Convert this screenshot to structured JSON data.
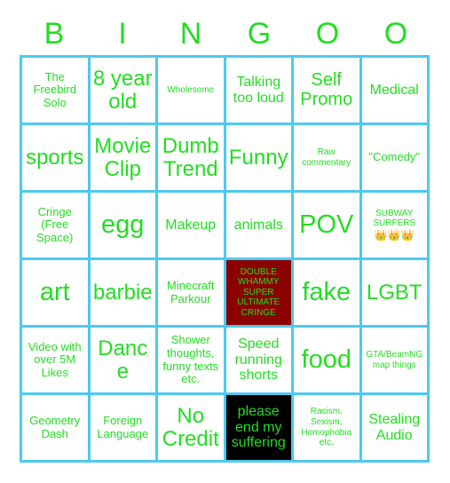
{
  "card": {
    "title_letters": [
      "B",
      "I",
      "N",
      "G",
      "O",
      "O"
    ],
    "colors": {
      "text_green": "#22dd22",
      "grid_border_cyan": "#4cc9f0",
      "cell_background": "#ffffff",
      "double_whammy_red": "#8b0000",
      "suffering_black": "#000000"
    },
    "rows": [
      [
        {
          "text": "The Freebird Solo",
          "size": "sm",
          "fill": "white"
        },
        {
          "text": "8 year old",
          "size": "xl",
          "fill": "white"
        },
        {
          "text": "Wholesome",
          "size": "xs",
          "fill": "white"
        },
        {
          "text": "Talking too loud",
          "size": "md",
          "fill": "white"
        },
        {
          "text": "Self Promo",
          "size": "lg",
          "fill": "white"
        },
        {
          "text": "Medical",
          "size": "md",
          "fill": "white"
        }
      ],
      [
        {
          "text": "sports",
          "size": "xl",
          "fill": "white"
        },
        {
          "text": "Movie Clip",
          "size": "xl",
          "fill": "white"
        },
        {
          "text": "Dumb Trend",
          "size": "xl",
          "fill": "white"
        },
        {
          "text": "Funny",
          "size": "xl",
          "fill": "white"
        },
        {
          "text": "Raw commentary",
          "size": "xs",
          "fill": "white"
        },
        {
          "text": "\"Comedy\"",
          "size": "sm",
          "fill": "white"
        }
      ],
      [
        {
          "text": "Cringe (Free Space)",
          "size": "sm",
          "fill": "white"
        },
        {
          "text": "egg",
          "size": "xxl",
          "fill": "white"
        },
        {
          "text": "Makeup",
          "size": "md",
          "fill": "white"
        },
        {
          "text": "animals",
          "size": "md",
          "fill": "white"
        },
        {
          "text": "POV",
          "size": "xxl",
          "fill": "white"
        },
        {
          "text": "SUBWAY SURFERS",
          "emoji": "👑👑👑",
          "size": "xs",
          "fill": "white"
        }
      ],
      [
        {
          "text": "art",
          "size": "xxl",
          "fill": "white"
        },
        {
          "text": "barbie",
          "size": "xl",
          "fill": "white"
        },
        {
          "text": "Minecraft Parkour",
          "size": "sm",
          "fill": "white"
        },
        {
          "text": "DOUBLE WHAMMY SUPER ULTIMATE CRINGE",
          "size": "xs",
          "fill": "red"
        },
        {
          "text": "fake",
          "size": "xxl",
          "fill": "white"
        },
        {
          "text": "LGBT",
          "size": "xl",
          "fill": "white"
        }
      ],
      [
        {
          "text": "Video with over 5M Likes",
          "size": "sm",
          "fill": "white"
        },
        {
          "text": "Dance",
          "size": "xl",
          "fill": "white"
        },
        {
          "text": "Shower thoughts, funny texts etc.",
          "size": "sm",
          "fill": "white"
        },
        {
          "text": "Speed running shorts",
          "size": "md",
          "fill": "white"
        },
        {
          "text": "food",
          "size": "xxl",
          "fill": "white"
        },
        {
          "text": "GTA/BeamNG map things",
          "size": "xs",
          "fill": "white"
        }
      ],
      [
        {
          "text": "Geometry Dash",
          "size": "sm",
          "fill": "white"
        },
        {
          "text": "Foreign Language",
          "size": "sm",
          "fill": "white"
        },
        {
          "text": "No Credit",
          "size": "xl",
          "fill": "white"
        },
        {
          "text": "please end my suffering",
          "size": "md",
          "fill": "black"
        },
        {
          "text": "Racism, Sexism, Homophobia etc.",
          "size": "xs",
          "fill": "white"
        },
        {
          "text": "Stealing Audio",
          "size": "md",
          "fill": "white"
        }
      ]
    ]
  }
}
